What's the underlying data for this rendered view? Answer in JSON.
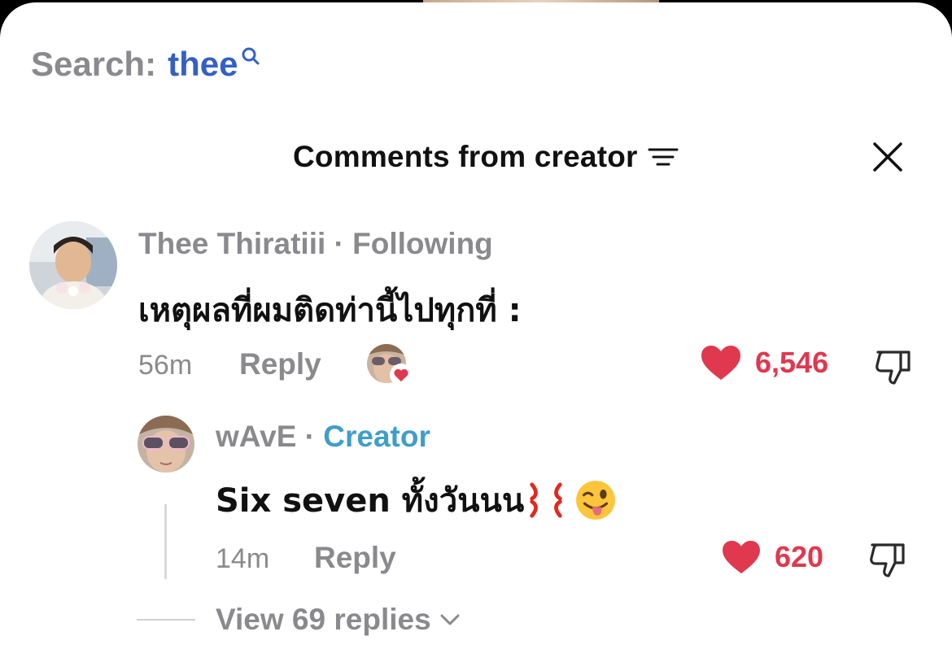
{
  "search": {
    "label": "Search:",
    "term": "thee"
  },
  "header": {
    "title": "Comments from creator"
  },
  "comment": {
    "username": "Thee Thiratiii",
    "separator": "·",
    "relation": "Following",
    "text": "เหตุผลที่ผมติดท่านี้ไปทุกที่ :",
    "time": "56m",
    "reply_label": "Reply",
    "likes": "6,546"
  },
  "reply": {
    "username": "wAvE",
    "separator": "·",
    "badge": "Creator",
    "text": "Six seven ทั้งวันนน",
    "emojis": [
      "anger-symbol",
      "winking-face-with-tongue"
    ],
    "time": "14m",
    "reply_label": "Reply",
    "likes": "620"
  },
  "view_replies": {
    "label": "View 69 replies"
  },
  "colors": {
    "accent_blue": "#3360c6",
    "creator_blue": "#3f9ec9",
    "like_red": "#e0384f",
    "muted": "#8a8a8e"
  }
}
